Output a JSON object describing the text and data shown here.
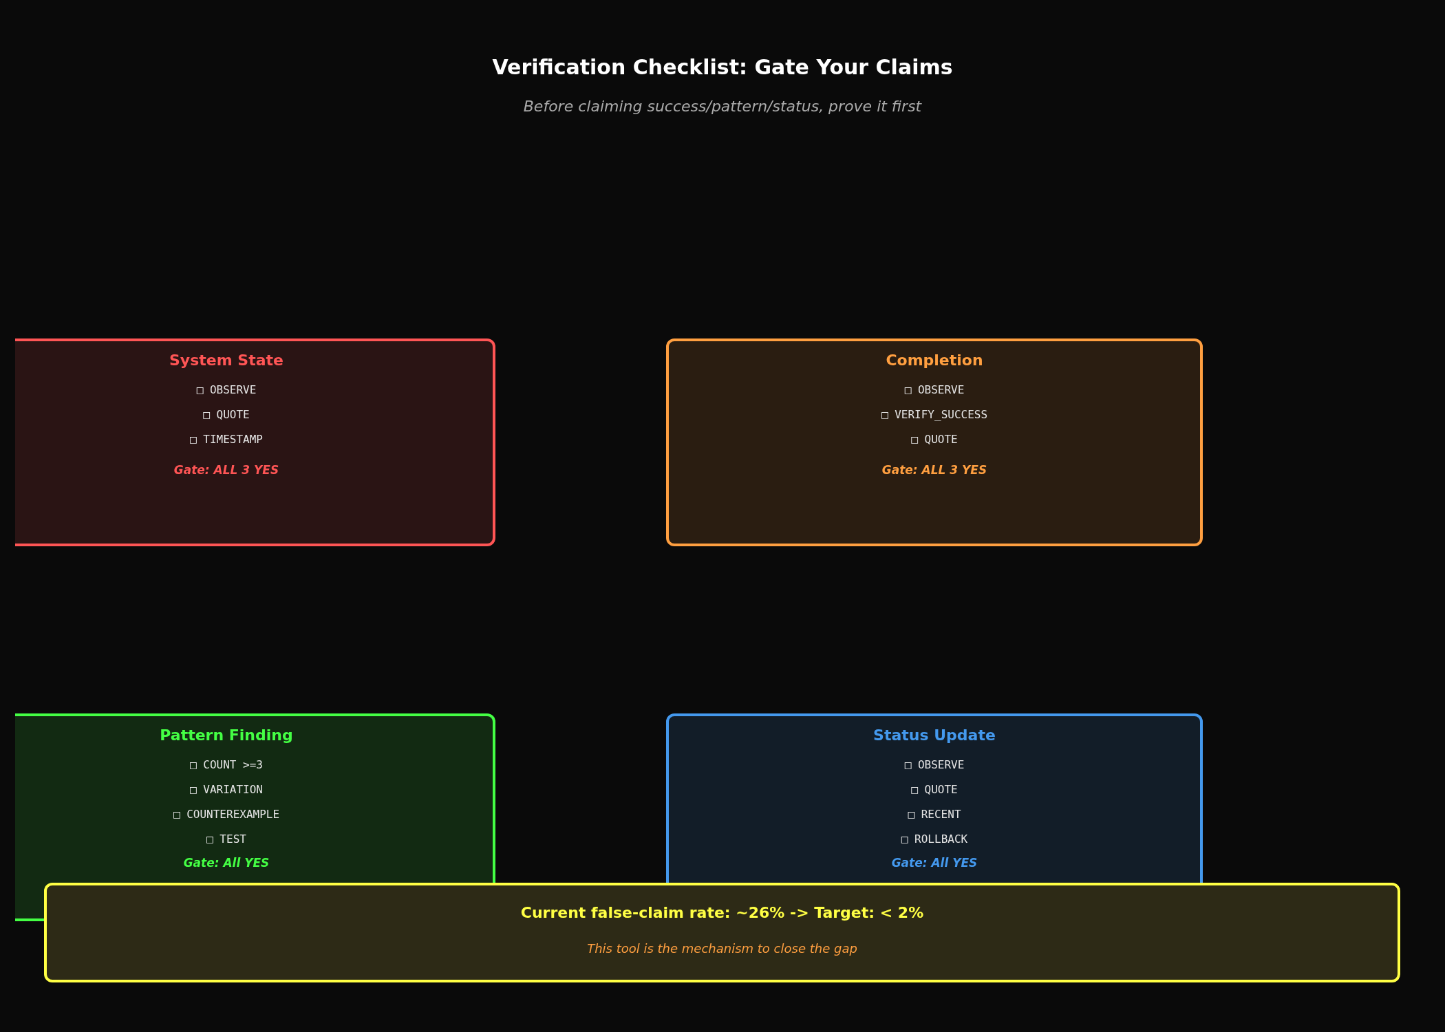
{
  "title": "Verification Checklist: Gate Your Claims",
  "subtitle": "Before claiming success/pattern/status, prove it first",
  "cards": [
    {
      "title": "System State",
      "color": "#ff5555",
      "items": [
        "□ OBSERVE",
        "□ QUOTE",
        "□ TIMESTAMP"
      ],
      "gate": "Gate: ALL 3 YES",
      "cut_left": true
    },
    {
      "title": "Completion",
      "color": "#ff9f40",
      "items": [
        "□ OBSERVE",
        "□ VERIFY_SUCCESS",
        "□ QUOTE"
      ],
      "gate": "Gate: ALL 3 YES",
      "cut_left": false
    },
    {
      "title": "Pattern Finding",
      "color": "#44ff44",
      "items": [
        "□ COUNT >=3",
        "□ VARIATION",
        "□ COUNTEREXAMPLE",
        "□ TEST"
      ],
      "gate": "Gate: All YES",
      "cut_left": true
    },
    {
      "title": "Status Update",
      "color": "#4499ee",
      "items": [
        "□ OBSERVE",
        "□ QUOTE",
        "□ RECENT",
        "□ ROLLBACK"
      ],
      "gate": "Gate: All YES",
      "cut_left": false
    }
  ],
  "banner": {
    "headline": "Current false-claim rate: ~26% -> Target: < 2%",
    "note": "This tool is the mechanism to close the gap"
  }
}
